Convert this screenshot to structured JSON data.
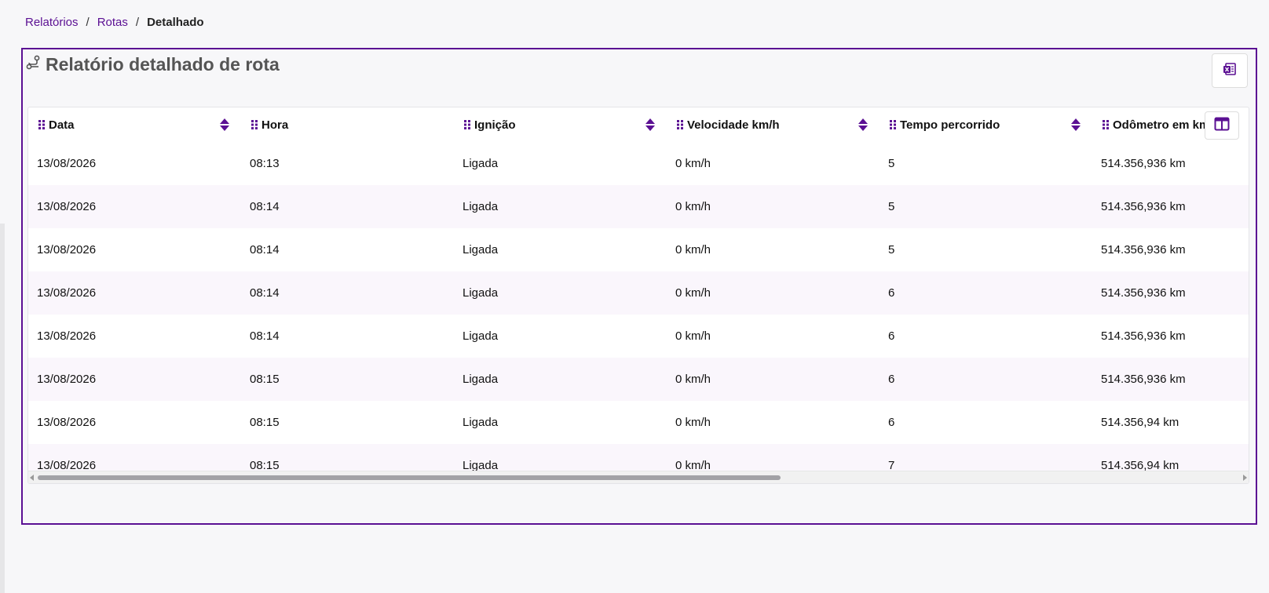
{
  "breadcrumb": {
    "items": [
      "Relatórios",
      "Rotas"
    ],
    "separator": "/",
    "current": "Detalhado"
  },
  "card": {
    "title": "Relatório detalhado de rota",
    "title_icon": "route-icon",
    "export_icon": "excel-icon",
    "columns_icon": "columns-icon",
    "accent_color": "#5b1093"
  },
  "table": {
    "columns": [
      "Data",
      "Hora",
      "Ignição",
      "Velocidade km/h",
      "Tempo percorrido",
      "Odômetro em km"
    ],
    "rows": [
      [
        "13/08/2026",
        "08:13",
        "Ligada",
        "0 km/h",
        "5",
        "514.356,936 km"
      ],
      [
        "13/08/2026",
        "08:14",
        "Ligada",
        "0 km/h",
        "5",
        "514.356,936 km"
      ],
      [
        "13/08/2026",
        "08:14",
        "Ligada",
        "0 km/h",
        "5",
        "514.356,936 km"
      ],
      [
        "13/08/2026",
        "08:14",
        "Ligada",
        "0 km/h",
        "6",
        "514.356,936 km"
      ],
      [
        "13/08/2026",
        "08:14",
        "Ligada",
        "0 km/h",
        "6",
        "514.356,936 km"
      ],
      [
        "13/08/2026",
        "08:15",
        "Ligada",
        "0 km/h",
        "6",
        "514.356,936 km"
      ],
      [
        "13/08/2026",
        "08:15",
        "Ligada",
        "0 km/h",
        "6",
        "514.356,94 km"
      ],
      [
        "13/08/2026",
        "08:15",
        "Ligada",
        "0 km/h",
        "7",
        "514.356,94 km"
      ]
    ]
  }
}
